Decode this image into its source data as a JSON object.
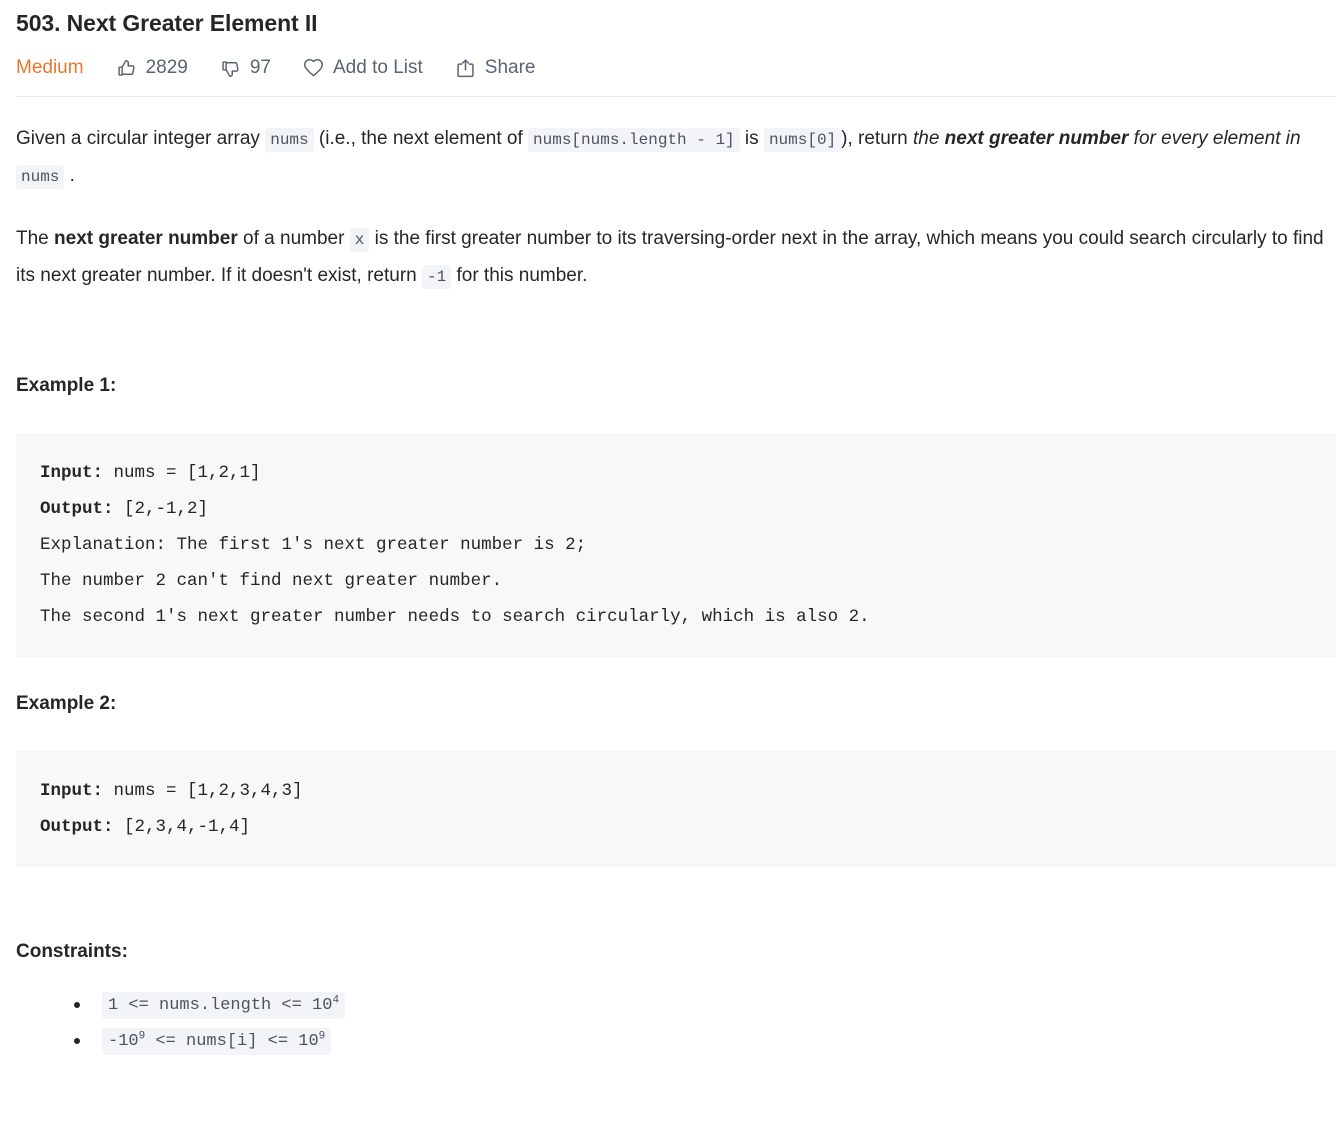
{
  "header": {
    "title": "503. Next Greater Element II",
    "difficulty": "Medium",
    "difficulty_color": "#e8762c",
    "likes_count": "2829",
    "dislikes_count": "97",
    "add_to_list_label": "Add to List",
    "share_label": "Share",
    "icons": {
      "like": "thumbs-up-icon",
      "dislike": "thumbs-down-icon",
      "favorite": "heart-icon",
      "share": "share-icon"
    }
  },
  "description": {
    "p1": {
      "t1": "Given a circular integer array ",
      "c1": "nums",
      "t2": " (i.e., the next element of ",
      "c2": "nums[nums.length - 1]",
      "t3": " is ",
      "c3": "nums[0]",
      "t4": "), return ",
      "i1": "the ",
      "bi1": "next greater number",
      "i2": " for every element in ",
      "c4": "nums",
      "t5": " ."
    },
    "p2": {
      "t1": "The ",
      "b1": "next greater number",
      "t2": " of a number ",
      "c1": "x",
      "t3": " is the first greater number to its traversing-order next in the array, which means you could search circularly to find its next greater number. If it doesn't exist, return ",
      "c2": "-1",
      "t4": " for this number."
    }
  },
  "examples": [
    {
      "heading": "Example 1:",
      "input_label": "Input:",
      "input_value": " nums = [1,2,1]",
      "output_label": "Output:",
      "output_value": " [2,-1,2]",
      "explanation_lines": [
        "Explanation: The first 1's next greater number is 2;",
        "The number 2 can't find next greater number.",
        "The second 1's next greater number needs to search circularly, which is also 2."
      ]
    },
    {
      "heading": "Example 2:",
      "input_label": "Input:",
      "input_value": " nums = [1,2,3,4,3]",
      "output_label": "Output:",
      "output_value": " [2,3,4,-1,4]",
      "explanation_lines": []
    }
  ],
  "constraints": {
    "heading": "Constraints:",
    "items": [
      {
        "pre": "1 <= nums.length <= 10",
        "sup": "4",
        "post": ""
      },
      {
        "pre": "-10",
        "sup": "9",
        "post": " <= nums[i] <= 10",
        "sup2": "9"
      }
    ]
  }
}
